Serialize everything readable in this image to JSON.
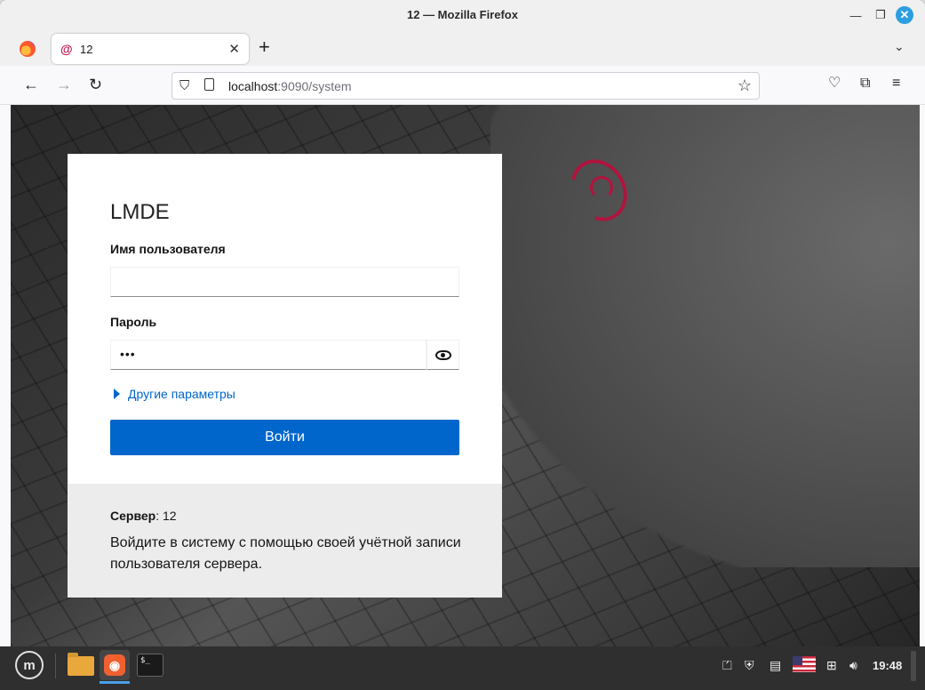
{
  "window": {
    "title": "12 — Mozilla Firefox"
  },
  "browser": {
    "tab": {
      "title": "12",
      "favicon": "debian-swirl-icon"
    },
    "url_host": "localhost",
    "url_rest": ":9090/system",
    "icons": [
      "back-arrow-icon",
      "forward-arrow-icon",
      "reload-icon",
      "shield-icon",
      "page-icon",
      "star-icon",
      "pocket-icon",
      "extensions-icon",
      "hamburger-menu-icon"
    ]
  },
  "login": {
    "brand": "LMDE",
    "username_label": "Имя пользователя",
    "username_value": "",
    "password_label": "Пароль",
    "password_value": "•••",
    "other_options": "Другие параметры",
    "submit_label": "Войти",
    "server_label": "Сервер",
    "server_value": ": 12",
    "help_text": "Войдите в систему с помощью своей учётной записи пользователя сервера."
  },
  "colors": {
    "accent": "#0066cc",
    "debian_red": "#b5123e",
    "taskbar": "#2f2f2f"
  },
  "taskbar": {
    "menu_glyph": "m",
    "terminal_glyph": "$_",
    "clock": "19:48"
  }
}
